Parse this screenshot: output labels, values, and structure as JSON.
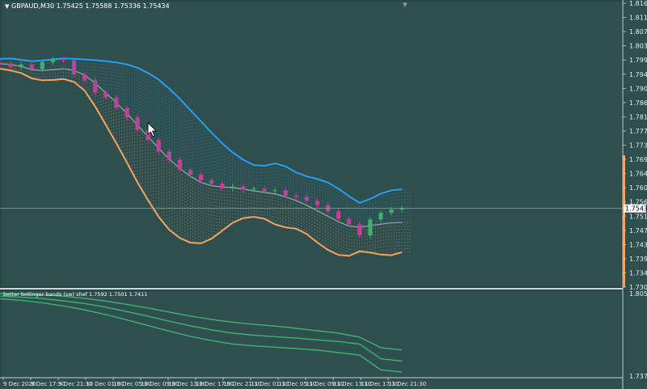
{
  "main_title": "GBPAUD,M30  1.75425 1.75588 1.75336 1.75434",
  "sub_title": "better bollinger bands (sw) shef 1.7592 1.7501 1.7411",
  "colors": {
    "background": "#2f4f4f",
    "upper": "#2a9df4",
    "lower": "#f4a460",
    "middle": "#8fa3a3",
    "bull": "#3cb371",
    "bear": "#c0409a",
    "sub_line": "#3cb371",
    "price_tag": "#ffffff",
    "axis_accent": "#f4a460"
  },
  "chart_data": [
    {
      "type": "candlestick",
      "title": "GBPAUD,M30  1.75425 1.75588 1.75336 1.75434",
      "symbol": "GBPAUD",
      "timeframe": "M30",
      "ohlc_last": {
        "open": 1.75425,
        "high": 1.75588,
        "low": 1.75336,
        "close": 1.75434
      },
      "current_price": "1.75434",
      "y_ticks": [
        "1.81628",
        "1.81198",
        "1.80768",
        "1.80338",
        "1.79908",
        "1.79478",
        "1.79058",
        "1.78628",
        "1.78198",
        "1.77768",
        "1.77338",
        "1.76918",
        "1.76488",
        "1.76058",
        "1.75628",
        "1.75198",
        "1.74768",
        "1.74348",
        "1.73918",
        "1.73488",
        "1.73058"
      ],
      "ylim": [
        1.73058,
        1.81628
      ],
      "x_ticks": [
        "9 Dec 2020",
        "9 Dec 17:30",
        "9 Dec 21:30",
        "10 Dec 01:30",
        "10 Dec 05:30",
        "10 Dec 09:30",
        "10 Dec 13:30",
        "10 Dec 17:30",
        "10 Dec 21:30",
        "11 Dec 01:30",
        "11 Dec 05:30",
        "11 Dec 09:30",
        "11 Dec 13:30",
        "11 Dec 17:30",
        "11 Dec 21:30"
      ],
      "bands": {
        "upper": [
          1.7995,
          1.7996,
          1.7992,
          1.7988,
          1.799,
          1.7993,
          1.7996,
          1.7995,
          1.7993,
          1.7991,
          1.7988,
          1.7984,
          1.7978,
          1.7968,
          1.7952,
          1.7932,
          1.7905,
          1.7874,
          1.784,
          1.7806,
          1.7772,
          1.774,
          1.7712,
          1.769,
          1.7674,
          1.7672,
          1.7679,
          1.767,
          1.7652,
          1.764,
          1.7632,
          1.7622,
          1.7603,
          1.758,
          1.756,
          1.7572,
          1.7588,
          1.7598,
          1.7601
        ],
        "middle": [
          1.798,
          1.7978,
          1.7972,
          1.7962,
          1.796,
          1.7962,
          1.7965,
          1.796,
          1.7946,
          1.7921,
          1.7892,
          1.7862,
          1.783,
          1.7795,
          1.776,
          1.7725,
          1.7692,
          1.7664,
          1.764,
          1.7622,
          1.7612,
          1.7608,
          1.7606,
          1.7602,
          1.7596,
          1.7592,
          1.7587,
          1.7578,
          1.7567,
          1.7553,
          1.7536,
          1.752,
          1.7503,
          1.749,
          1.7487,
          1.7491,
          1.7496,
          1.75,
          1.7501
        ],
        "lower": [
          1.7965,
          1.796,
          1.7952,
          1.7936,
          1.793,
          1.7931,
          1.7934,
          1.7925,
          1.7899,
          1.7851,
          1.7796,
          1.774,
          1.7682,
          1.7622,
          1.7568,
          1.7518,
          1.7479,
          1.7454,
          1.744,
          1.7438,
          1.7452,
          1.7476,
          1.75,
          1.7514,
          1.7518,
          1.7512,
          1.7495,
          1.7486,
          1.7482,
          1.7466,
          1.744,
          1.7418,
          1.7403,
          1.74,
          1.7414,
          1.741,
          1.7404,
          1.7402,
          1.7411
        ]
      },
      "closes": [
        1.798,
        1.797,
        1.7978,
        1.7964,
        1.7985,
        1.7992,
        1.799,
        1.7948,
        1.793,
        1.7893,
        1.7878,
        1.7847,
        1.7818,
        1.778,
        1.775,
        1.7715,
        1.769,
        1.766,
        1.7645,
        1.7628,
        1.7618,
        1.7604,
        1.761,
        1.76,
        1.7603,
        1.7596,
        1.7598,
        1.7582,
        1.7578,
        1.7566,
        1.7553,
        1.7535,
        1.7512,
        1.7495,
        1.7462,
        1.751,
        1.753,
        1.754,
        1.7543
      ]
    },
    {
      "type": "line",
      "title": "better bollinger bands (sw) shef 1.7592 1.7501 1.7411",
      "y_ticks": [
        "1.8051",
        "1.7379"
      ],
      "ylim": [
        1.7379,
        1.8051
      ],
      "series": [
        {
          "values": [
            1.8051,
            1.8048,
            1.804,
            1.803,
            1.8012,
            1.799,
            1.7963,
            1.7933,
            1.79,
            1.7868,
            1.784,
            1.7818,
            1.78,
            1.7786,
            1.7768,
            1.7748,
            1.7728,
            1.7696,
            1.761,
            1.7592
          ]
        },
        {
          "values": [
            1.803,
            1.8022,
            1.801,
            1.7992,
            1.797,
            1.794,
            1.7905,
            1.7866,
            1.7826,
            1.7788,
            1.7755,
            1.7728,
            1.7712,
            1.77,
            1.7688,
            1.7674,
            1.766,
            1.764,
            1.752,
            1.7501
          ]
        },
        {
          "values": [
            1.8009,
            1.7996,
            1.7976,
            1.795,
            1.7918,
            1.788,
            1.7836,
            1.779,
            1.7745,
            1.7702,
            1.7668,
            1.764,
            1.7625,
            1.7614,
            1.7603,
            1.759,
            1.757,
            1.755,
            1.743,
            1.7411
          ]
        }
      ]
    }
  ]
}
